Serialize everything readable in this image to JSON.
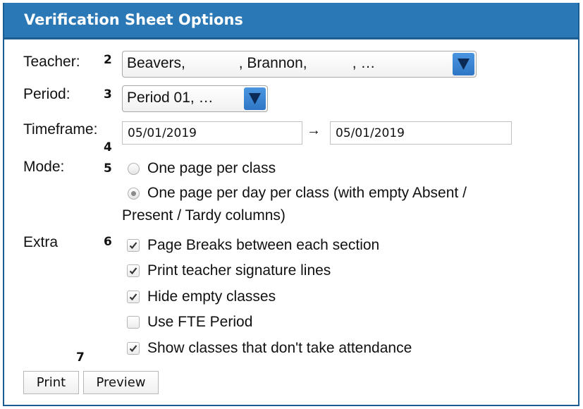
{
  "header": {
    "title": "Verification Sheet Options"
  },
  "teacher": {
    "label": "Teacher:",
    "marker": "2",
    "value": "Beavers,             , Brannon,           , …"
  },
  "period": {
    "label": "Period:",
    "marker": "3",
    "value": "Period 01, …"
  },
  "timeframe": {
    "label": "Timeframe:",
    "marker": "4",
    "start": "05/01/2019",
    "separator": "→",
    "end": "05/01/2019"
  },
  "mode": {
    "label": "Mode:",
    "marker": "5",
    "options": [
      {
        "label": "One page per class",
        "selected": false
      },
      {
        "label_line1": "One page per day per class (with empty Absent /",
        "label_line2": "Present / Tardy columns)",
        "selected": true
      }
    ]
  },
  "extra": {
    "label": "Extra",
    "marker": "6",
    "options": [
      {
        "label": "Page Breaks between each section",
        "checked": true
      },
      {
        "label": "Print teacher signature lines",
        "checked": true
      },
      {
        "label": "Hide empty classes",
        "checked": true
      },
      {
        "label": "Use FTE Period",
        "checked": false
      },
      {
        "label": "Show classes that don't take attendance",
        "checked": true
      }
    ]
  },
  "actions": {
    "marker": "7",
    "print_label": "Print",
    "preview_label": "Preview"
  },
  "colors": {
    "header_bg": "#2a78b5",
    "select_arrow": "#2f77c6"
  }
}
